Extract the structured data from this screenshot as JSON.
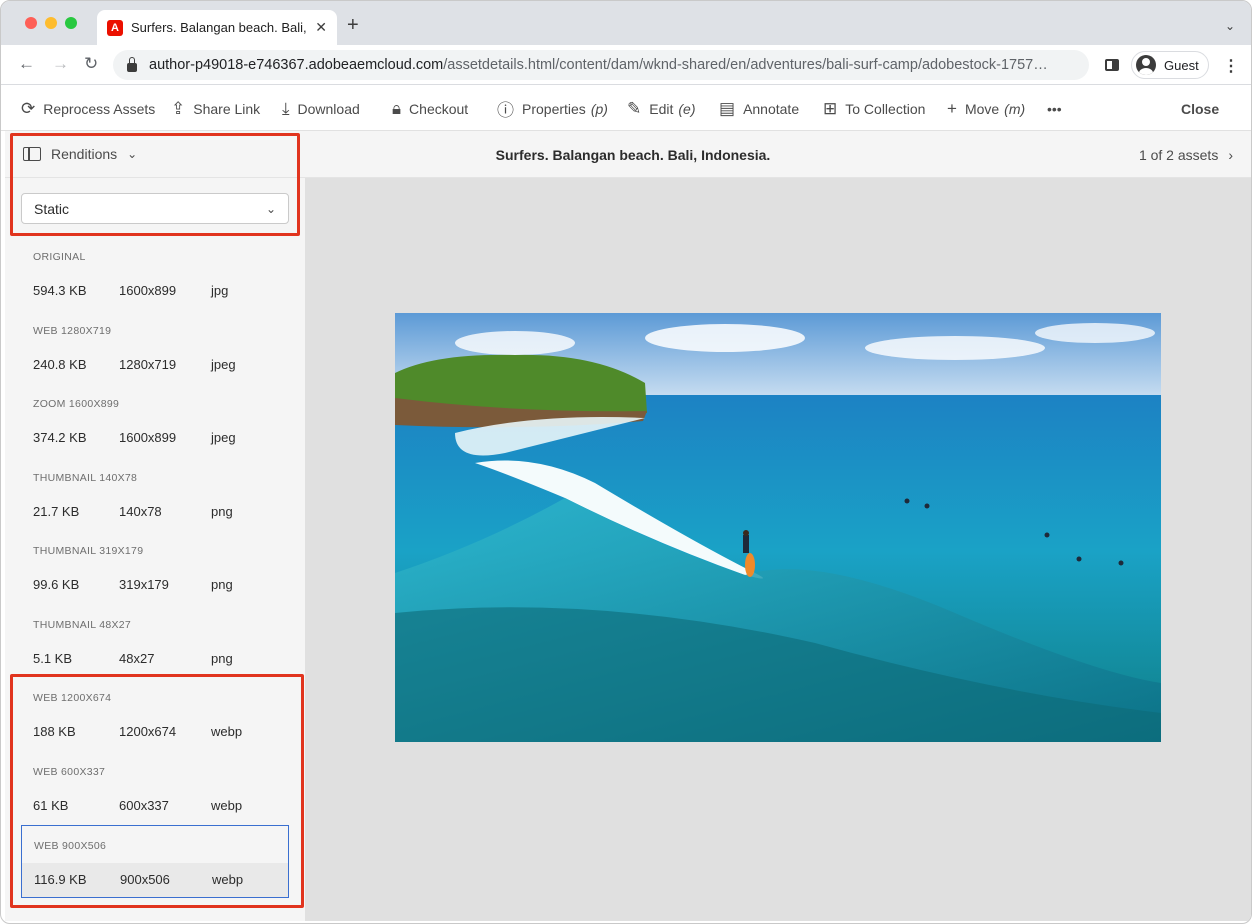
{
  "browser": {
    "tab_title": "Surfers. Balangan beach. Bali, I",
    "tab_favicon": "A",
    "url_host": "author-p49018-e746367.adobeaemcloud.com",
    "url_path": "/assetdetails.html/content/dam/wknd-shared/en/adventures/bali-surf-camp/adobestock-1757…",
    "profile_label": "Guest",
    "icons": [
      "back-icon",
      "forward-icon",
      "reload-icon",
      "lock-icon",
      "side-panel-icon",
      "profile-icon",
      "menu-icon"
    ]
  },
  "actions": [
    {
      "label": "Reprocess Assets",
      "icon": "reprocess-icon"
    },
    {
      "label": "Share Link",
      "icon": "share-icon"
    },
    {
      "label": "Download",
      "icon": "download-icon"
    },
    {
      "label": "Checkout",
      "icon": "lock-icon"
    },
    {
      "label": "Properties",
      "shortcut": "(p)",
      "icon": "info-icon"
    },
    {
      "label": "Edit",
      "shortcut": "(e)",
      "icon": "pencil-icon"
    },
    {
      "label": "Annotate",
      "icon": "annotate-icon"
    },
    {
      "label": "To Collection",
      "icon": "collection-icon"
    },
    {
      "label": "Move",
      "shortcut": "(m)",
      "icon": "move-icon"
    },
    {
      "label": "•••",
      "icon": "more-icon"
    }
  ],
  "close_label": "Close",
  "rail": {
    "title": "Renditions",
    "filter": "Static",
    "renditions": [
      {
        "name": "ORIGINAL",
        "size": "594.3 KB",
        "dimensions": "1600x899",
        "format": "jpg"
      },
      {
        "name": "WEB 1280X719",
        "size": "240.8 KB",
        "dimensions": "1280x719",
        "format": "jpeg"
      },
      {
        "name": "ZOOM 1600X899",
        "size": "374.2 KB",
        "dimensions": "1600x899",
        "format": "jpeg"
      },
      {
        "name": "THUMBNAIL 140X78",
        "size": "21.7 KB",
        "dimensions": "140x78",
        "format": "png"
      },
      {
        "name": "THUMBNAIL 319X179",
        "size": "99.6 KB",
        "dimensions": "319x179",
        "format": "png"
      },
      {
        "name": "THUMBNAIL 48X27",
        "size": "5.1 KB",
        "dimensions": "48x27",
        "format": "png"
      },
      {
        "name": "WEB 1200X674",
        "size": "188 KB",
        "dimensions": "1200x674",
        "format": "webp"
      },
      {
        "name": "WEB 600X337",
        "size": "61 KB",
        "dimensions": "600x337",
        "format": "webp"
      },
      {
        "name": "WEB 900X506",
        "size": "116.9 KB",
        "dimensions": "900x506",
        "format": "webp",
        "selected": true
      }
    ]
  },
  "preview": {
    "title": "Surfers. Balangan beach. Bali, Indonesia.",
    "pager": "1 of 2 assets"
  },
  "colors": {
    "highlight": "#e1341e",
    "selection": "#3a6fd0"
  }
}
